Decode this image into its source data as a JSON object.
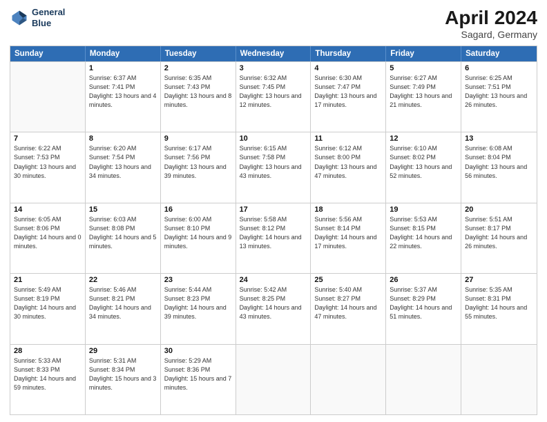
{
  "header": {
    "logo_line1": "General",
    "logo_line2": "Blue",
    "title": "April 2024",
    "subtitle": "Sagard, Germany"
  },
  "weekdays": [
    "Sunday",
    "Monday",
    "Tuesday",
    "Wednesday",
    "Thursday",
    "Friday",
    "Saturday"
  ],
  "rows": [
    [
      {
        "day": "",
        "sunrise": "",
        "sunset": "",
        "daylight": ""
      },
      {
        "day": "1",
        "sunrise": "Sunrise: 6:37 AM",
        "sunset": "Sunset: 7:41 PM",
        "daylight": "Daylight: 13 hours and 4 minutes."
      },
      {
        "day": "2",
        "sunrise": "Sunrise: 6:35 AM",
        "sunset": "Sunset: 7:43 PM",
        "daylight": "Daylight: 13 hours and 8 minutes."
      },
      {
        "day": "3",
        "sunrise": "Sunrise: 6:32 AM",
        "sunset": "Sunset: 7:45 PM",
        "daylight": "Daylight: 13 hours and 12 minutes."
      },
      {
        "day": "4",
        "sunrise": "Sunrise: 6:30 AM",
        "sunset": "Sunset: 7:47 PM",
        "daylight": "Daylight: 13 hours and 17 minutes."
      },
      {
        "day": "5",
        "sunrise": "Sunrise: 6:27 AM",
        "sunset": "Sunset: 7:49 PM",
        "daylight": "Daylight: 13 hours and 21 minutes."
      },
      {
        "day": "6",
        "sunrise": "Sunrise: 6:25 AM",
        "sunset": "Sunset: 7:51 PM",
        "daylight": "Daylight: 13 hours and 26 minutes."
      }
    ],
    [
      {
        "day": "7",
        "sunrise": "Sunrise: 6:22 AM",
        "sunset": "Sunset: 7:53 PM",
        "daylight": "Daylight: 13 hours and 30 minutes."
      },
      {
        "day": "8",
        "sunrise": "Sunrise: 6:20 AM",
        "sunset": "Sunset: 7:54 PM",
        "daylight": "Daylight: 13 hours and 34 minutes."
      },
      {
        "day": "9",
        "sunrise": "Sunrise: 6:17 AM",
        "sunset": "Sunset: 7:56 PM",
        "daylight": "Daylight: 13 hours and 39 minutes."
      },
      {
        "day": "10",
        "sunrise": "Sunrise: 6:15 AM",
        "sunset": "Sunset: 7:58 PM",
        "daylight": "Daylight: 13 hours and 43 minutes."
      },
      {
        "day": "11",
        "sunrise": "Sunrise: 6:12 AM",
        "sunset": "Sunset: 8:00 PM",
        "daylight": "Daylight: 13 hours and 47 minutes."
      },
      {
        "day": "12",
        "sunrise": "Sunrise: 6:10 AM",
        "sunset": "Sunset: 8:02 PM",
        "daylight": "Daylight: 13 hours and 52 minutes."
      },
      {
        "day": "13",
        "sunrise": "Sunrise: 6:08 AM",
        "sunset": "Sunset: 8:04 PM",
        "daylight": "Daylight: 13 hours and 56 minutes."
      }
    ],
    [
      {
        "day": "14",
        "sunrise": "Sunrise: 6:05 AM",
        "sunset": "Sunset: 8:06 PM",
        "daylight": "Daylight: 14 hours and 0 minutes."
      },
      {
        "day": "15",
        "sunrise": "Sunrise: 6:03 AM",
        "sunset": "Sunset: 8:08 PM",
        "daylight": "Daylight: 14 hours and 5 minutes."
      },
      {
        "day": "16",
        "sunrise": "Sunrise: 6:00 AM",
        "sunset": "Sunset: 8:10 PM",
        "daylight": "Daylight: 14 hours and 9 minutes."
      },
      {
        "day": "17",
        "sunrise": "Sunrise: 5:58 AM",
        "sunset": "Sunset: 8:12 PM",
        "daylight": "Daylight: 14 hours and 13 minutes."
      },
      {
        "day": "18",
        "sunrise": "Sunrise: 5:56 AM",
        "sunset": "Sunset: 8:14 PM",
        "daylight": "Daylight: 14 hours and 17 minutes."
      },
      {
        "day": "19",
        "sunrise": "Sunrise: 5:53 AM",
        "sunset": "Sunset: 8:15 PM",
        "daylight": "Daylight: 14 hours and 22 minutes."
      },
      {
        "day": "20",
        "sunrise": "Sunrise: 5:51 AM",
        "sunset": "Sunset: 8:17 PM",
        "daylight": "Daylight: 14 hours and 26 minutes."
      }
    ],
    [
      {
        "day": "21",
        "sunrise": "Sunrise: 5:49 AM",
        "sunset": "Sunset: 8:19 PM",
        "daylight": "Daylight: 14 hours and 30 minutes."
      },
      {
        "day": "22",
        "sunrise": "Sunrise: 5:46 AM",
        "sunset": "Sunset: 8:21 PM",
        "daylight": "Daylight: 14 hours and 34 minutes."
      },
      {
        "day": "23",
        "sunrise": "Sunrise: 5:44 AM",
        "sunset": "Sunset: 8:23 PM",
        "daylight": "Daylight: 14 hours and 39 minutes."
      },
      {
        "day": "24",
        "sunrise": "Sunrise: 5:42 AM",
        "sunset": "Sunset: 8:25 PM",
        "daylight": "Daylight: 14 hours and 43 minutes."
      },
      {
        "day": "25",
        "sunrise": "Sunrise: 5:40 AM",
        "sunset": "Sunset: 8:27 PM",
        "daylight": "Daylight: 14 hours and 47 minutes."
      },
      {
        "day": "26",
        "sunrise": "Sunrise: 5:37 AM",
        "sunset": "Sunset: 8:29 PM",
        "daylight": "Daylight: 14 hours and 51 minutes."
      },
      {
        "day": "27",
        "sunrise": "Sunrise: 5:35 AM",
        "sunset": "Sunset: 8:31 PM",
        "daylight": "Daylight: 14 hours and 55 minutes."
      }
    ],
    [
      {
        "day": "28",
        "sunrise": "Sunrise: 5:33 AM",
        "sunset": "Sunset: 8:33 PM",
        "daylight": "Daylight: 14 hours and 59 minutes."
      },
      {
        "day": "29",
        "sunrise": "Sunrise: 5:31 AM",
        "sunset": "Sunset: 8:34 PM",
        "daylight": "Daylight: 15 hours and 3 minutes."
      },
      {
        "day": "30",
        "sunrise": "Sunrise: 5:29 AM",
        "sunset": "Sunset: 8:36 PM",
        "daylight": "Daylight: 15 hours and 7 minutes."
      },
      {
        "day": "",
        "sunrise": "",
        "sunset": "",
        "daylight": ""
      },
      {
        "day": "",
        "sunrise": "",
        "sunset": "",
        "daylight": ""
      },
      {
        "day": "",
        "sunrise": "",
        "sunset": "",
        "daylight": ""
      },
      {
        "day": "",
        "sunrise": "",
        "sunset": "",
        "daylight": ""
      }
    ]
  ]
}
